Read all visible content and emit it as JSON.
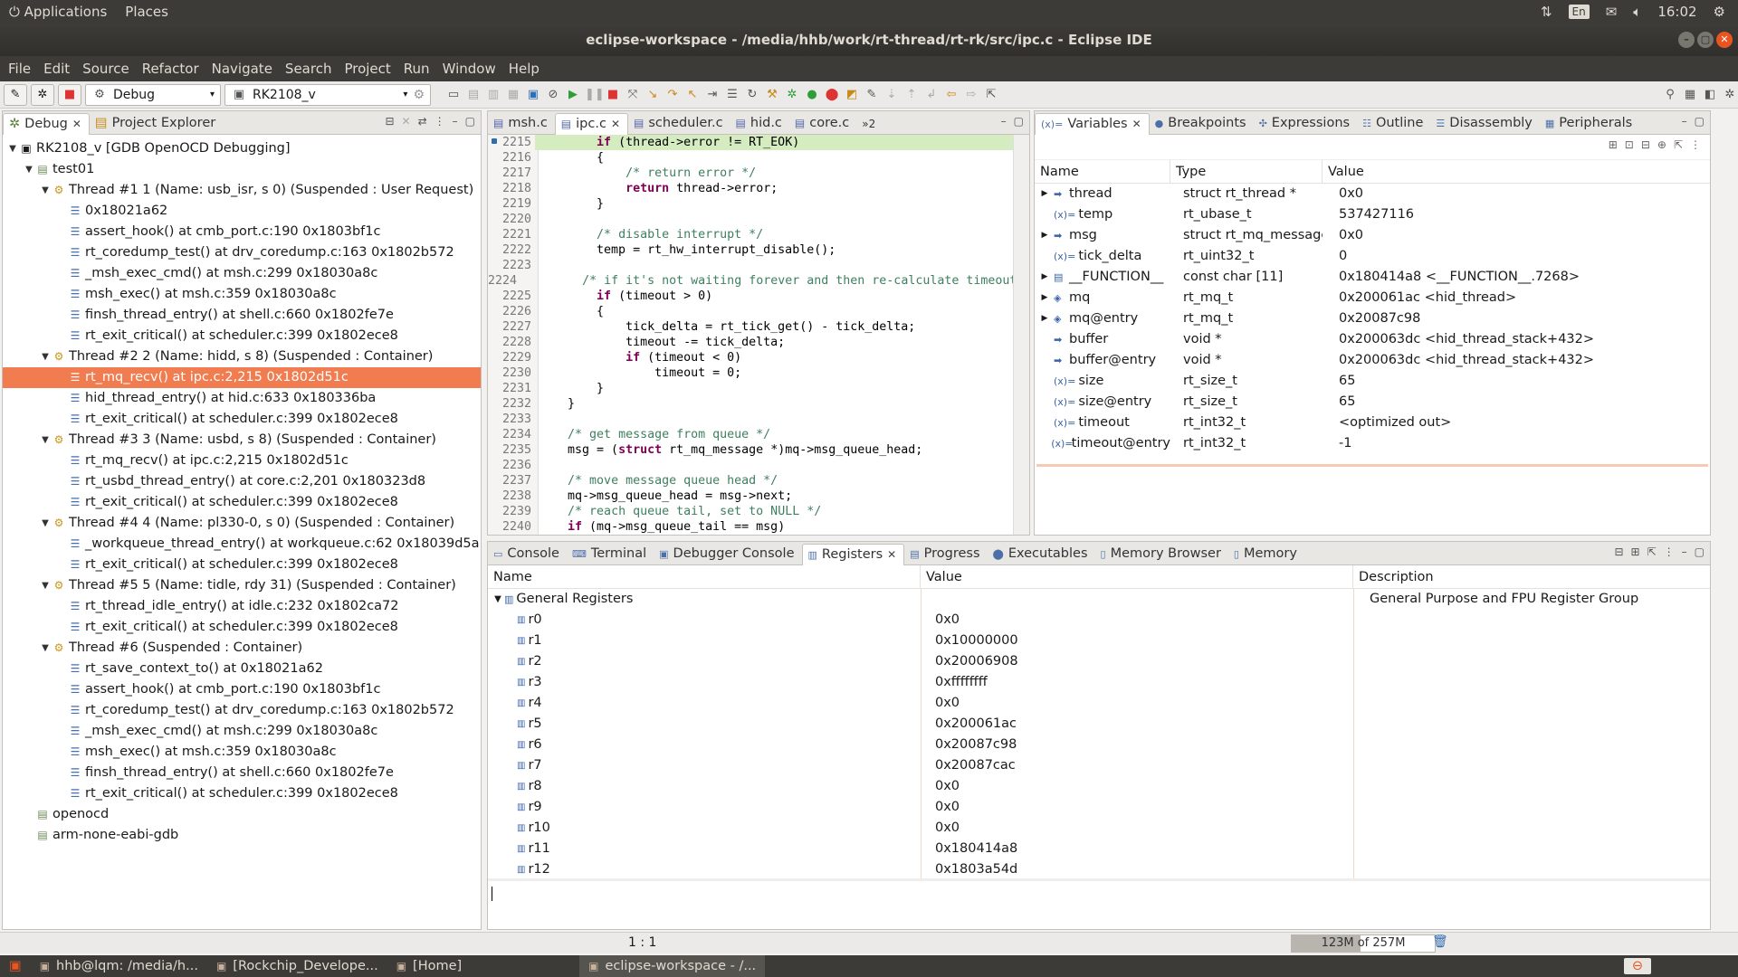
{
  "topbar": {
    "applications": "Applications",
    "places": "Places",
    "keyboard": "En",
    "clock": "16:02"
  },
  "window": {
    "title": "eclipse-workspace - /media/hhb/work/rt-thread/rt-rk/src/ipc.c - Eclipse IDE"
  },
  "menu": [
    "File",
    "Edit",
    "Source",
    "Refactor",
    "Navigate",
    "Search",
    "Project",
    "Run",
    "Window",
    "Help"
  ],
  "toolbar": {
    "launch_mode": "Debug",
    "launch_config": "RK2108_v"
  },
  "debug_view": {
    "tabs": [
      {
        "label": "Debug",
        "active": true
      },
      {
        "label": "Project Explorer",
        "active": false
      }
    ],
    "tree": [
      {
        "level": 0,
        "twisty": "▼",
        "type": "launch",
        "text": "RK2108_v [GDB OpenOCD Debugging]"
      },
      {
        "level": 1,
        "twisty": "▼",
        "type": "proc",
        "text": "test01"
      },
      {
        "level": 2,
        "twisty": "▼",
        "type": "thread",
        "text": "Thread #1 1 (Name: usb_isr, s 0) (Suspended : User Request)"
      },
      {
        "level": 3,
        "twisty": "",
        "type": "frame",
        "text": "0x18021a62"
      },
      {
        "level": 3,
        "twisty": "",
        "type": "frame",
        "text": "assert_hook() at cmb_port.c:190 0x1803bf1c"
      },
      {
        "level": 3,
        "twisty": "",
        "type": "frame",
        "text": "rt_coredump_test() at drv_coredump.c:163 0x1802b572"
      },
      {
        "level": 3,
        "twisty": "",
        "type": "frame",
        "text": "_msh_exec_cmd() at msh.c:299 0x18030a8c"
      },
      {
        "level": 3,
        "twisty": "",
        "type": "frame",
        "text": "msh_exec() at msh.c:359 0x18030a8c"
      },
      {
        "level": 3,
        "twisty": "",
        "type": "frame",
        "text": "finsh_thread_entry() at shell.c:660 0x1802fe7e"
      },
      {
        "level": 3,
        "twisty": "",
        "type": "frame",
        "text": "rt_exit_critical() at scheduler.c:399 0x1802ece8"
      },
      {
        "level": 2,
        "twisty": "▼",
        "type": "thread",
        "text": "Thread #2 2 (Name: hidd, s 8) (Suspended : Container)"
      },
      {
        "level": 3,
        "twisty": "",
        "type": "frame",
        "text": "rt_mq_recv() at ipc.c:2,215 0x1802d51c",
        "selected": true
      },
      {
        "level": 3,
        "twisty": "",
        "type": "frame",
        "text": "hid_thread_entry() at hid.c:633 0x180336ba"
      },
      {
        "level": 3,
        "twisty": "",
        "type": "frame",
        "text": "rt_exit_critical() at scheduler.c:399 0x1802ece8"
      },
      {
        "level": 2,
        "twisty": "▼",
        "type": "thread",
        "text": "Thread #3 3 (Name: usbd, s 8) (Suspended : Container)"
      },
      {
        "level": 3,
        "twisty": "",
        "type": "frame",
        "text": "rt_mq_recv() at ipc.c:2,215 0x1802d51c"
      },
      {
        "level": 3,
        "twisty": "",
        "type": "frame",
        "text": "rt_usbd_thread_entry() at core.c:2,201 0x180323d8"
      },
      {
        "level": 3,
        "twisty": "",
        "type": "frame",
        "text": "rt_exit_critical() at scheduler.c:399 0x1802ece8"
      },
      {
        "level": 2,
        "twisty": "▼",
        "type": "thread",
        "text": "Thread #4 4 (Name: pl330-0, s 0) (Suspended : Container)"
      },
      {
        "level": 3,
        "twisty": "",
        "type": "frame",
        "text": "_workqueue_thread_entry() at workqueue.c:62 0x18039d5a"
      },
      {
        "level": 3,
        "twisty": "",
        "type": "frame",
        "text": "rt_exit_critical() at scheduler.c:399 0x1802ece8"
      },
      {
        "level": 2,
        "twisty": "▼",
        "type": "thread",
        "text": "Thread #5 5 (Name: tidle, rdy 31) (Suspended : Container)"
      },
      {
        "level": 3,
        "twisty": "",
        "type": "frame",
        "text": "rt_thread_idle_entry() at idle.c:232 0x1802ca72"
      },
      {
        "level": 3,
        "twisty": "",
        "type": "frame",
        "text": "rt_exit_critical() at scheduler.c:399 0x1802ece8"
      },
      {
        "level": 2,
        "twisty": "▼",
        "type": "thread",
        "text": "Thread #6 (Suspended : Container)"
      },
      {
        "level": 3,
        "twisty": "",
        "type": "frame",
        "text": "rt_save_context_to() at 0x18021a62"
      },
      {
        "level": 3,
        "twisty": "",
        "type": "frame",
        "text": "assert_hook() at cmb_port.c:190 0x1803bf1c"
      },
      {
        "level": 3,
        "twisty": "",
        "type": "frame",
        "text": "rt_coredump_test() at drv_coredump.c:163 0x1802b572"
      },
      {
        "level": 3,
        "twisty": "",
        "type": "frame",
        "text": "_msh_exec_cmd() at msh.c:299 0x18030a8c"
      },
      {
        "level": 3,
        "twisty": "",
        "type": "frame",
        "text": "msh_exec() at msh.c:359 0x18030a8c"
      },
      {
        "level": 3,
        "twisty": "",
        "type": "frame",
        "text": "finsh_thread_entry() at shell.c:660 0x1802fe7e"
      },
      {
        "level": 3,
        "twisty": "",
        "type": "frame",
        "text": "rt_exit_critical() at scheduler.c:399 0x1802ece8"
      },
      {
        "level": 1,
        "twisty": "",
        "type": "proc",
        "text": "openocd"
      },
      {
        "level": 1,
        "twisty": "",
        "type": "proc",
        "text": "arm-none-eabi-gdb"
      }
    ]
  },
  "editor": {
    "tabs": [
      {
        "label": "msh.c",
        "active": false
      },
      {
        "label": "ipc.c",
        "active": true
      },
      {
        "label": "scheduler.c",
        "active": false
      },
      {
        "label": "hid.c",
        "active": false
      },
      {
        "label": "core.c",
        "active": false
      }
    ],
    "overflow": "»2",
    "lines": [
      {
        "n": "2215",
        "code": "        if (thread->error != RT_EOK)",
        "current": true
      },
      {
        "n": "2216",
        "code": "        {"
      },
      {
        "n": "2217",
        "code": "            /* return error */"
      },
      {
        "n": "2218",
        "code": "            return thread->error;"
      },
      {
        "n": "2219",
        "code": "        }"
      },
      {
        "n": "2220",
        "code": ""
      },
      {
        "n": "2221",
        "code": "        /* disable interrupt */"
      },
      {
        "n": "2222",
        "code": "        temp = rt_hw_interrupt_disable();"
      },
      {
        "n": "2223",
        "code": ""
      },
      {
        "n": "2224",
        "code": "        /* if it's not waiting forever and then re-calculate timeout"
      },
      {
        "n": "2225",
        "code": "        if (timeout > 0)"
      },
      {
        "n": "2226",
        "code": "        {"
      },
      {
        "n": "2227",
        "code": "            tick_delta = rt_tick_get() - tick_delta;"
      },
      {
        "n": "2228",
        "code": "            timeout -= tick_delta;"
      },
      {
        "n": "2229",
        "code": "            if (timeout < 0)"
      },
      {
        "n": "2230",
        "code": "                timeout = 0;"
      },
      {
        "n": "2231",
        "code": "        }"
      },
      {
        "n": "2232",
        "code": "    }"
      },
      {
        "n": "2233",
        "code": ""
      },
      {
        "n": "2234",
        "code": "    /* get message from queue */"
      },
      {
        "n": "2235",
        "code": "    msg = (struct rt_mq_message *)mq->msg_queue_head;"
      },
      {
        "n": "2236",
        "code": ""
      },
      {
        "n": "2237",
        "code": "    /* move message queue head */"
      },
      {
        "n": "2238",
        "code": "    mq->msg_queue_head = msg->next;"
      },
      {
        "n": "2239",
        "code": "    /* reach queue tail, set to NULL */"
      },
      {
        "n": "2240",
        "code": "    if (mq->msg_queue_tail == msg)"
      }
    ]
  },
  "variables_view": {
    "tabs": [
      {
        "label": "Variables",
        "icon": "(x)=",
        "active": true
      },
      {
        "label": "Breakpoints",
        "icon": "●",
        "active": false
      },
      {
        "label": "Expressions",
        "icon": "✣",
        "active": false
      },
      {
        "label": "Outline",
        "icon": "☷",
        "active": false
      },
      {
        "label": "Disassembly",
        "icon": "☰",
        "active": false
      },
      {
        "label": "Peripherals",
        "icon": "▦",
        "active": false
      }
    ],
    "columns": {
      "name": "Name",
      "type": "Type",
      "value": "Value"
    },
    "rows": [
      {
        "twisty": "▶",
        "icon": "➡",
        "name": "thread",
        "type": "struct rt_thread *",
        "value": "0x0"
      },
      {
        "twisty": "",
        "icon": "(x)=",
        "name": "temp",
        "type": "rt_ubase_t",
        "value": "537427116"
      },
      {
        "twisty": "▶",
        "icon": "➡",
        "name": "msg",
        "type": "struct rt_mq_message *",
        "value": "0x0"
      },
      {
        "twisty": "",
        "icon": "(x)=",
        "name": "tick_delta",
        "type": "rt_uint32_t",
        "value": "0"
      },
      {
        "twisty": "▶",
        "icon": "▤",
        "name": "__FUNCTION__",
        "type": "const char [11]",
        "value": "0x180414a8 <__FUNCTION__.7268>"
      },
      {
        "twisty": "▶",
        "icon": "◈",
        "name": "mq",
        "type": "rt_mq_t",
        "value": "0x200061ac <hid_thread>"
      },
      {
        "twisty": "▶",
        "icon": "◈",
        "name": "mq@entry",
        "type": "rt_mq_t",
        "value": "0x20087c98"
      },
      {
        "twisty": "",
        "icon": "➡",
        "name": "buffer",
        "type": "void *",
        "value": "0x200063dc <hid_thread_stack+432>"
      },
      {
        "twisty": "",
        "icon": "➡",
        "name": "buffer@entry",
        "type": "void *",
        "value": "0x200063dc <hid_thread_stack+432>"
      },
      {
        "twisty": "",
        "icon": "(x)=",
        "name": "size",
        "type": "rt_size_t",
        "value": "65"
      },
      {
        "twisty": "",
        "icon": "(x)=",
        "name": "size@entry",
        "type": "rt_size_t",
        "value": "65"
      },
      {
        "twisty": "",
        "icon": "(x)=",
        "name": "timeout",
        "type": "rt_int32_t",
        "value": "<optimized out>"
      },
      {
        "twisty": "",
        "icon": "(x)=",
        "name": "timeout@entry",
        "type": "rt_int32_t",
        "value": "-1"
      }
    ]
  },
  "bottom_view": {
    "tabs": [
      {
        "label": "Console",
        "icon": "▭",
        "active": false
      },
      {
        "label": "Terminal",
        "icon": "⌨",
        "active": false
      },
      {
        "label": "Debugger Console",
        "icon": "▣",
        "active": false
      },
      {
        "label": "Registers",
        "icon": "▥",
        "active": true
      },
      {
        "label": "Progress",
        "icon": "▤",
        "active": false
      },
      {
        "label": "Executables",
        "icon": "⬤",
        "active": false
      },
      {
        "label": "Memory Browser",
        "icon": "▯",
        "active": false
      },
      {
        "label": "Memory",
        "icon": "▯",
        "active": false
      }
    ],
    "columns": {
      "name": "Name",
      "value": "Value",
      "description": "Description"
    },
    "group": {
      "name": "General Registers",
      "description": "General Purpose and FPU Register Group"
    },
    "registers": [
      {
        "name": "r0",
        "value": "0x0"
      },
      {
        "name": "r1",
        "value": "0x10000000"
      },
      {
        "name": "r2",
        "value": "0x20006908"
      },
      {
        "name": "r3",
        "value": "0xffffffff"
      },
      {
        "name": "r4",
        "value": "0x0"
      },
      {
        "name": "r5",
        "value": "0x200061ac"
      },
      {
        "name": "r6",
        "value": "0x20087c98"
      },
      {
        "name": "r7",
        "value": "0x20087cac"
      },
      {
        "name": "r8",
        "value": "0x0"
      },
      {
        "name": "r9",
        "value": "0x0"
      },
      {
        "name": "r10",
        "value": "0x0"
      },
      {
        "name": "r11",
        "value": "0x180414a8"
      },
      {
        "name": "r12",
        "value": "0x1803a54d"
      }
    ]
  },
  "status": {
    "cursor": "1 : 1",
    "heap": "123M of 257M",
    "heap_used_fraction": 0.48
  },
  "taskbar": [
    {
      "label": "hhb@lqm: /media/h...",
      "active": false
    },
    {
      "label": "[Rockchip_Develope...",
      "active": false
    },
    {
      "label": "[Home]",
      "active": false
    },
    {
      "label": "eclipse-workspace - /...",
      "active": true
    }
  ]
}
